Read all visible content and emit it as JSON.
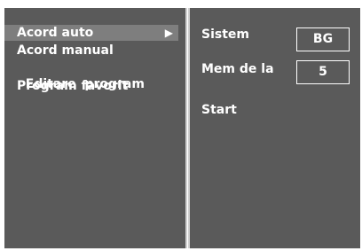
{
  "menu": {
    "items": [
      {
        "label": "Acord auto",
        "selected": true,
        "arrow": "▶"
      },
      {
        "label": "Acord manual",
        "selected": false
      },
      {
        "label": "Editare  program",
        "selected": false
      },
      {
        "label": "Program favorit",
        "selected": false
      }
    ]
  },
  "settings": {
    "sistem": {
      "label": "Sistem",
      "value": "BG"
    },
    "mem": {
      "label": "Mem de la",
      "value": "5"
    },
    "start": {
      "label": "Start"
    }
  },
  "colors": {
    "panel": "#5a5a5a",
    "highlight": "#7e7e7e",
    "text": "#ffffff"
  }
}
